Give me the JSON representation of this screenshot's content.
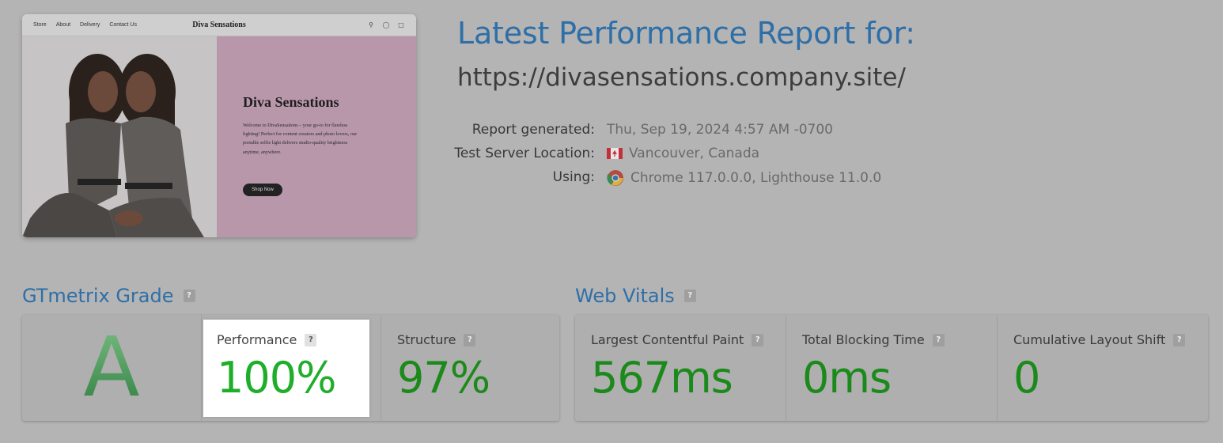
{
  "header": {
    "title": "Latest Performance Report for:",
    "url": "https://divasensations.company.site/"
  },
  "report_meta": [
    {
      "label": "Report generated:",
      "value": "Thu, Sep 19, 2024 4:57 AM -0700",
      "icon": ""
    },
    {
      "label": "Test Server Location:",
      "value": "Vancouver, Canada",
      "icon": "canada-flag-icon"
    },
    {
      "label": "Using:",
      "value": "Chrome 117.0.0.0, Lighthouse 11.0.0",
      "icon": "chrome-icon"
    }
  ],
  "thumbnail": {
    "nav_links": [
      "Store",
      "About",
      "Delivery",
      "Contact Us"
    ],
    "brand": "Diva Sensations",
    "nav_icons": [
      "search-icon",
      "account-icon",
      "cart-icon"
    ],
    "hero_title": "Diva Sensations",
    "hero_text": "Welcome to DivaSensations – your go-to for flawless lighting! Perfect for content creators and photo lovers, our portable selfie light delivers studio-quality brightness anytime, anywhere.",
    "cta": "Shop Now"
  },
  "grade_section": {
    "title": "GTmetrix Grade",
    "help": "?",
    "grade": "A",
    "performance": {
      "label": "Performance",
      "value": "100%"
    },
    "structure": {
      "label": "Structure",
      "value": "97%"
    }
  },
  "vitals_section": {
    "title": "Web Vitals",
    "help": "?",
    "lcp": {
      "label": "Largest Contentful Paint",
      "value": "567ms"
    },
    "tbt": {
      "label": "Total Blocking Time",
      "value": "0ms"
    },
    "cls": {
      "label": "Cumulative Layout Shift",
      "value": "0"
    }
  },
  "colors": {
    "background": "#b4b4b4",
    "accent_blue": "#2e6fa7",
    "good_green": "#1b8a1b",
    "highlight_green": "#1fae2a",
    "grade_green": "#4f9a5c"
  }
}
